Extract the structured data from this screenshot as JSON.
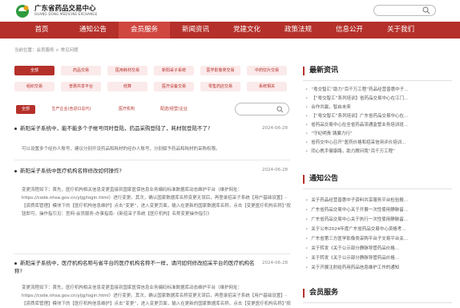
{
  "header": {
    "title": "广东省药品交易中心",
    "subtitle": "GUANG DONG MEDICINE EXCHANGE"
  },
  "nav": [
    "首页",
    "通知公告",
    "会员服务",
    "新闻资讯",
    "党建文化",
    "政策法规",
    "信息公开",
    "关于我们"
  ],
  "breadcrumb": "当前位置：会员服务 > 常见问题",
  "categories": [
    [
      "全部",
      "药品交易",
      "医用耗材交易",
      "新阳采子系统",
      "医学影像类交易",
      "中药饮片交易"
    ],
    [
      "组织交易",
      "普惠共享平台",
      "结算",
      "医疗设备交易",
      "零售药店交易",
      "系统相关"
    ]
  ],
  "filters": [
    "全部",
    "生产企业(含进口总代)",
    "医疗机构",
    "配送(经营)企业"
  ],
  "articles": [
    {
      "title": "新阳采子系统中，能不能多个子帐号同时登陆，药品采购登陆了，耗材就登陆不了?",
      "date": "2024-06-28",
      "body": "可以设置多个经办人账号，建议分别开设药品和耗材的经办人账号，分别赋予药品和耗材的采购权限。"
    },
    {
      "title": "新阳采子系统中医疗机构名称修改如何操作?",
      "date": "2024-06-28",
      "body": "变更流程如下：首先，医疗机构相关信息变更直接到国家医保信息业务编码标准数据库动态维护平台（维护网址：https://code.nhsa.gov.cn/yljg/login.html）进行变更。其次，确认国家数据库名称变更无误后，再登录招采子系统【用户基础设置】-【资质库管理】模块下的【医疗机构信息维护】点击“变更”，进入变更页面，输入在更新的国家数据库名称，点击【变更医疗机构名称】”按钮即可。操作指引见：官网-会员服务-办事指南-《新招采子系统【医疗机构】名称变更操作指引》"
    },
    {
      "title": "新阳采子系统中，医疗机构名称与省平台的医疗机构名称不一样，请问如何修改招采平台的医疗机构名称?",
      "date": "2024-06-28",
      "body": "变更流程如下：首先，医疗机构相关信息变更直接到国家医保信息业务编码标准数据库动态维护平台（维护网址：https://code.nhsa.gov.cn/yljg/login.html）进行变更。其次，确认国家数据库名称变更无误后，再登录招采子系统【用户基础设置】-【资质库管理】模块下的【医疗机构信息维护】点击“变更”，进入变更页面，输入在更新的国家数据库名称，点击【变更医疗机构名称】”按钮即可。操作指引见：官网-会员服务-办事指南-《新招采子系统【医疗机构】名称变更操作指引》"
    }
  ],
  "sidebar": {
    "news_title": "最新资讯",
    "news": [
      "“粤交智汇”助力“百千万工程”药品经营普惠中子...",
      "【“粤交智汇”系列培训】省药品交易中心在江门...",
      "合作共赢，智启未来",
      "【“粤交智汇”系列培训】广东省药品交易中心在...",
      "省药品交易中心在全省药品流通监管业务培训班...",
      "“守纪明责 铸廉力行”",
      "省药交中心召开“医药价格和招采信用评价培训...",
      "同心携手健康路，助力脾问我“百千万工程”"
    ],
    "notice_title": "通知公告",
    "notices": [
      "关于药品经营普惠中子资料共享服务平台检验报...",
      "广东省药品交易中心关于开展一次性使用静脉留...",
      "广东省药品交易中心关于执行一次性使用静脉留...",
      "关于公布2024年度广东省药品交易中心资格考...",
      "广东省第三方医学影像类采购平台子交易平台关...",
      "关于转发《关于公示部分静脉导管药品价格...",
      "关于转发《关于公示部分静脉导管药品价格...",
      "关于开展注射给药用药品信息维护工作的通知"
    ],
    "member_title": "会员服务"
  },
  "colors": {
    "brand": "#b5302a",
    "nav_active": "#d04740",
    "cat_bg": "#fbeaea"
  }
}
